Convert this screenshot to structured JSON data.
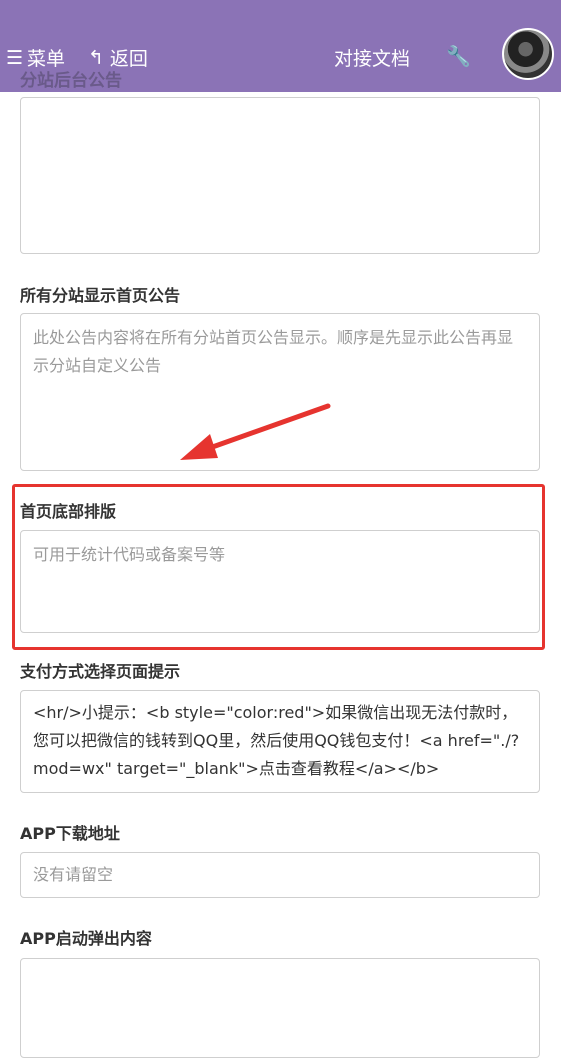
{
  "header": {
    "menu_label": "菜单",
    "back_label": "返回",
    "docs_label": "对接文档",
    "wrench_icon": "wrench-icon",
    "color": "#8b73b6"
  },
  "fields": {
    "substation_notice": {
      "label": "分站后台公告",
      "value": ""
    },
    "all_substation_notice": {
      "label": "所有分站显示首页公告",
      "placeholder": "此处公告内容将在所有分站首页公告显示。顺序是先显示此公告再显示分站自定义公告"
    },
    "footer_layout": {
      "label": "首页底部排版",
      "placeholder": "可用于统计代码或备案号等"
    },
    "payment_tip": {
      "label": "支付方式选择页面提示",
      "value": "<hr/>小提示：<b style=\"color:red\">如果微信出现无法付款时，您可以把微信的钱转到QQ里，然后使用QQ钱包支付！<a href=\"./?mod=wx\" target=\"_blank\">点击查看教程</a></b>"
    },
    "app_download": {
      "label": "APP下载地址",
      "placeholder": "没有请留空"
    },
    "app_popup": {
      "label": "APP启动弹出内容",
      "value": ""
    }
  },
  "annotation_color": "#e6342f"
}
